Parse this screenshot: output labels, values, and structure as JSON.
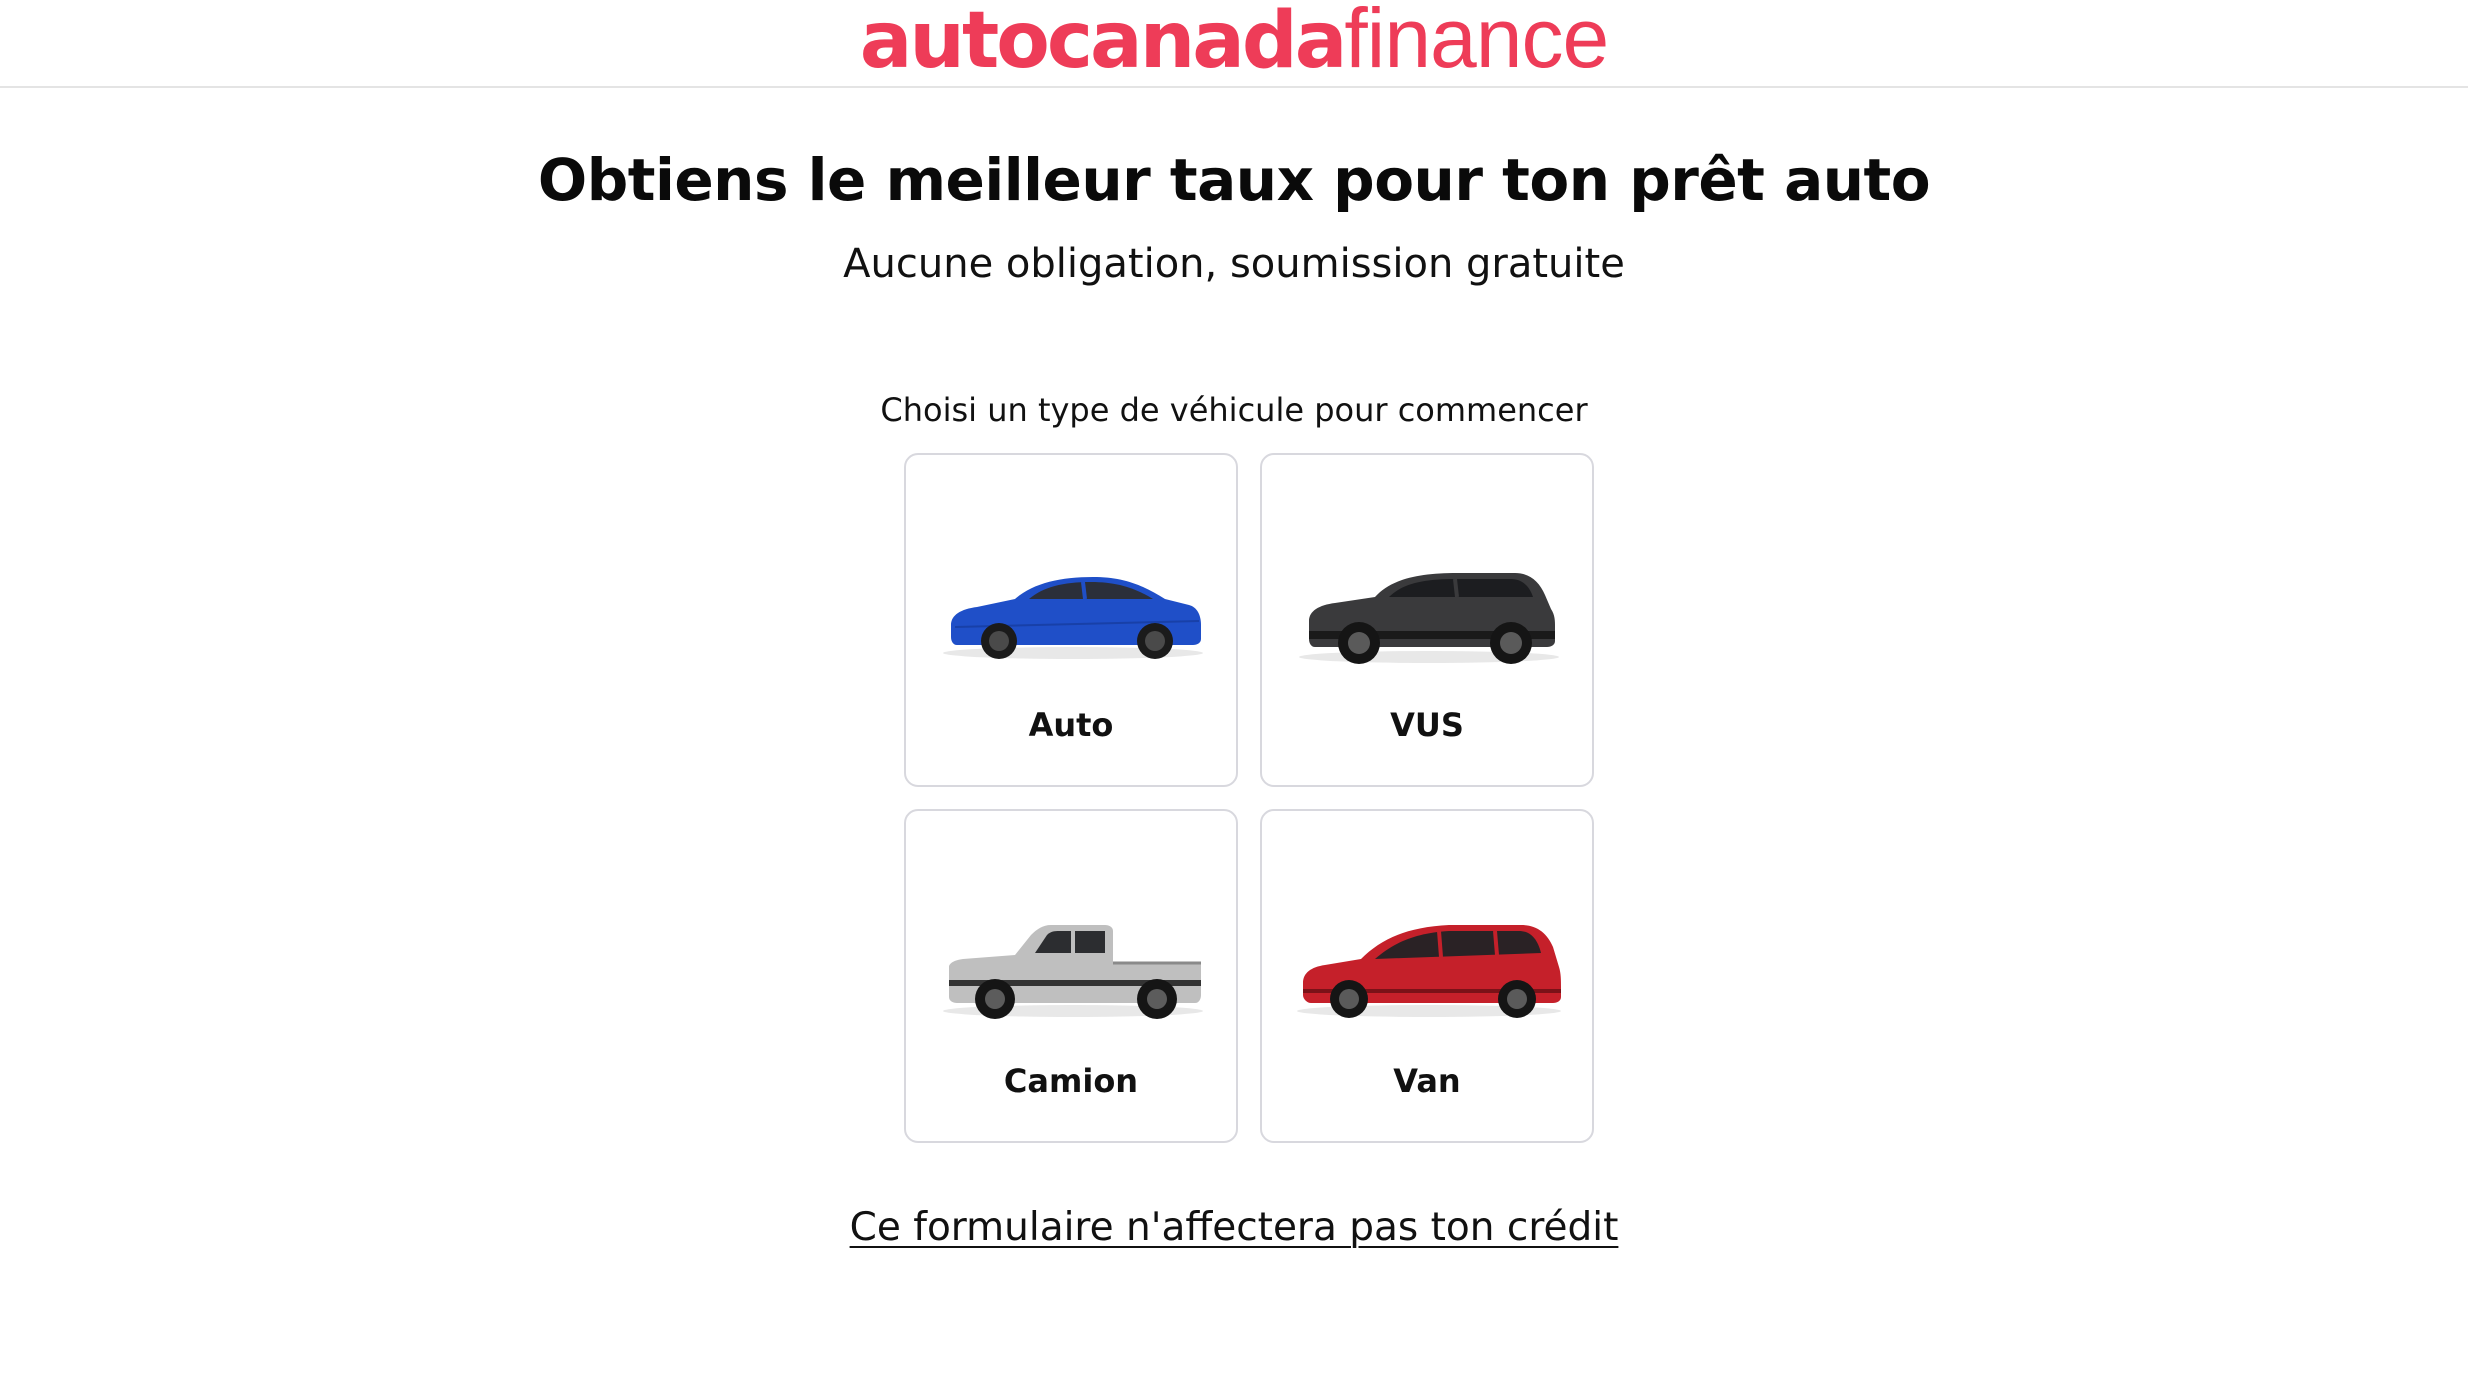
{
  "header": {
    "logo_bold": "autocanada",
    "logo_light": "finance",
    "brand_color": "#ee3c58"
  },
  "hero": {
    "title": "Obtiens le meilleur taux pour ton prêt auto",
    "subtitle": "Aucune obligation, soumission gratuite"
  },
  "vehicle_picker": {
    "prompt": "Choisi un type de véhicule pour commencer",
    "options": [
      {
        "label": "Auto",
        "icon": "sedan-image",
        "color": "#1f4fc8"
      },
      {
        "label": "VUS",
        "icon": "suv-image",
        "color": "#3a3a3c"
      },
      {
        "label": "Camion",
        "icon": "pickup-truck-image",
        "color": "#b9b9b9"
      },
      {
        "label": "Van",
        "icon": "minivan-image",
        "color": "#c5202a"
      }
    ]
  },
  "footer": {
    "link_text": "Ce formulaire n'affectera pas ton crédit"
  }
}
